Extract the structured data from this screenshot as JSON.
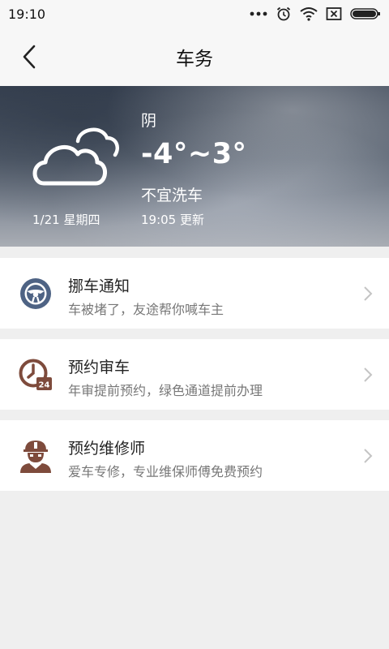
{
  "status_bar": {
    "time": "19:10"
  },
  "header": {
    "title": "车务"
  },
  "weather": {
    "condition": "阴",
    "temperature": "-4°~3°",
    "car_wash": "不宜洗车",
    "date": "1/21 星期四",
    "update_time": "19:05 更新"
  },
  "services": [
    {
      "title": "挪车通知",
      "subtitle": "车被堵了，友途帮你喊车主",
      "icon": "steering-wheel-icon"
    },
    {
      "title": "预约审车",
      "subtitle": "年审提前预约，绿色通道提前办理",
      "icon": "clock-24h-icon"
    },
    {
      "title": "预约维修师",
      "subtitle": "爱车专修，专业维保师傅免费预约",
      "icon": "mechanic-icon"
    }
  ],
  "colors": {
    "steering_icon": "#4e6384",
    "clock_icon": "#7e4b3c",
    "mechanic_icon": "#7e4b3c",
    "background": "#efefef"
  }
}
